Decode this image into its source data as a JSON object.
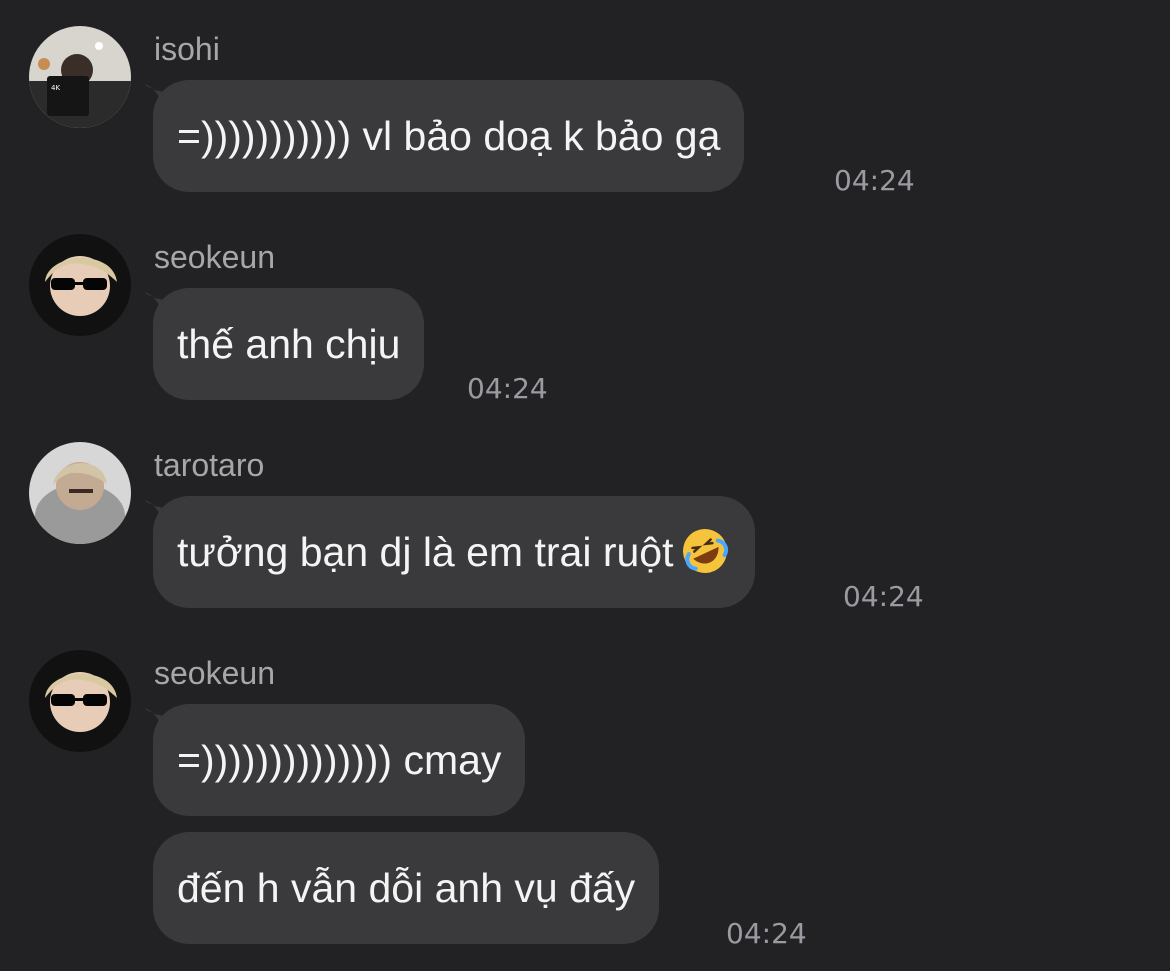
{
  "messages": [
    {
      "sender": "isohi",
      "text": "=))))))))))) vl bảo doạ k bảo gạ",
      "time": "04:24"
    },
    {
      "sender": "seokeun",
      "text": "thế anh chịu",
      "time": "04:24"
    },
    {
      "sender": "tarotaro",
      "text": "tưởng bạn dj là em trai ruột",
      "emoji": "rolling-on-the-floor-laughing-emoji",
      "time": "04:24"
    },
    {
      "sender": "seokeun",
      "text": "=)))))))))))))) cmay"
    },
    {
      "text": "đến h vẫn dỗi anh vụ đấy",
      "time": "04:24"
    }
  ],
  "colors": {
    "background": "#222225",
    "bubble": "#3a3a3d",
    "sender_text": "#a6a6ab",
    "timestamp": "#9a9aa0",
    "message_text": "#f4f4f4"
  }
}
